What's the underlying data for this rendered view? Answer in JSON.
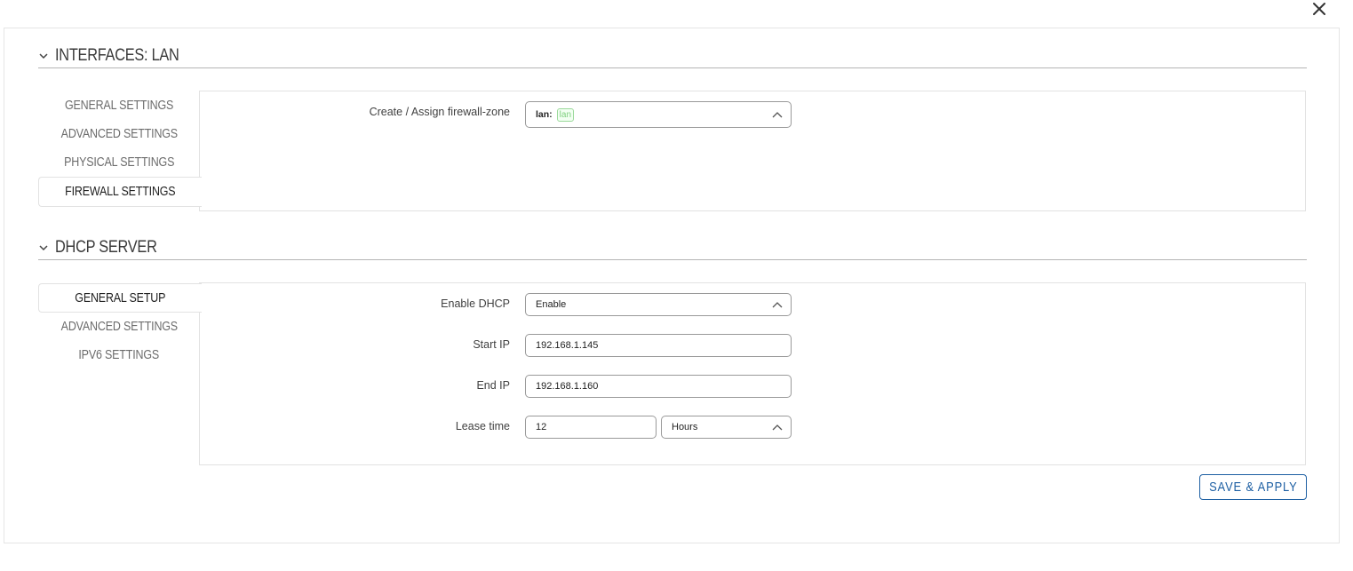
{
  "window": {
    "close_icon": "close-icon"
  },
  "interfaces_section": {
    "title": "INTERFACES: LAN",
    "tabs": [
      {
        "label": "GENERAL SETTINGS"
      },
      {
        "label": "ADVANCED SETTINGS"
      },
      {
        "label": "PHYSICAL SETTINGS"
      },
      {
        "label": "FIREWALL SETTINGS",
        "active": true
      }
    ],
    "firewall": {
      "label": "Create / Assign firewall-zone",
      "zone_name": "lan:",
      "zone_chip": "lan"
    }
  },
  "dhcp_section": {
    "title": "DHCP SERVER",
    "tabs": [
      {
        "label": "GENERAL SETUP",
        "active": true
      },
      {
        "label": "ADVANCED SETTINGS"
      },
      {
        "label": "IPV6 SETTINGS"
      }
    ],
    "fields": {
      "enable_label": "Enable DHCP",
      "enable_value": "Enable",
      "start_ip_label": "Start IP",
      "start_ip_value": "192.168.1.145",
      "end_ip_label": "End IP",
      "end_ip_value": "192.168.1.160",
      "lease_label": "Lease time",
      "lease_value": "12",
      "lease_unit": "Hours"
    }
  },
  "actions": {
    "save_label": "SAVE & APPLY"
  },
  "colors": {
    "accent": "#1d5fa3",
    "zone_chip": "#7fd07f",
    "border": "#e2e2e2"
  }
}
